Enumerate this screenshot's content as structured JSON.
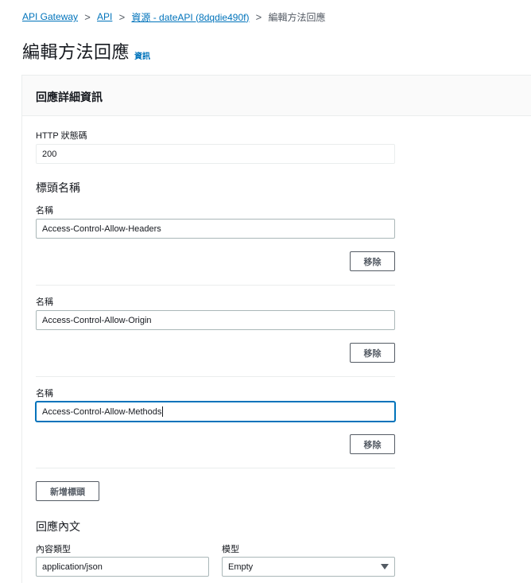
{
  "breadcrumb": {
    "items": [
      "API Gateway",
      "API",
      "資源 - dateAPI (8dqdie490f)"
    ],
    "current": "編輯方法回應",
    "separator": ">"
  },
  "page": {
    "title": "編輯方法回應",
    "info_link": "資訊"
  },
  "panel": {
    "title": "回應詳細資訊",
    "status_code_label": "HTTP 狀態碼",
    "status_code_value": "200",
    "headers_section_title": "標頭名稱",
    "headers": [
      {
        "label": "名稱",
        "value": "Access-Control-Allow-Headers",
        "remove_label": "移除"
      },
      {
        "label": "名稱",
        "value": "Access-Control-Allow-Origin",
        "remove_label": "移除"
      },
      {
        "label": "名稱",
        "value": "Access-Control-Allow-Methods",
        "remove_label": "移除"
      }
    ],
    "add_header_label": "新增標頭",
    "body_section_title": "回應內文",
    "content_type_label": "內容類型",
    "content_type_value": "application/json",
    "model_label": "模型",
    "model_value": "Empty"
  },
  "colors": {
    "link": "#0073bb",
    "text": "#16191f",
    "muted": "#545b64",
    "border": "#aab7b8",
    "divider": "#eaeded",
    "header_bg": "#fafafa"
  }
}
